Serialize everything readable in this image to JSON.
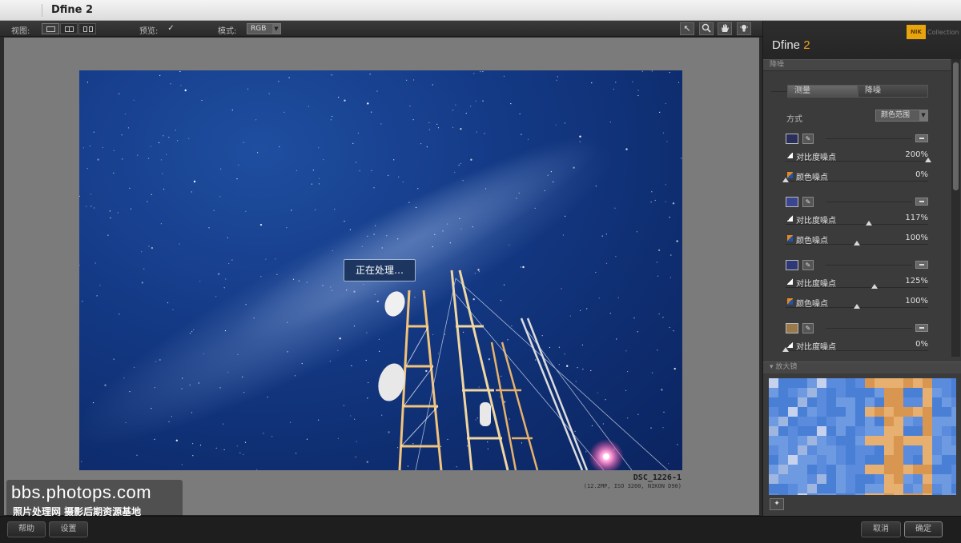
{
  "window": {
    "title": "Dfine 2"
  },
  "toolbar": {
    "view_label": "视图:",
    "preview_label": "预览:",
    "preview_checked": "✓",
    "mode_label": "模式:",
    "mode_value": "RGB"
  },
  "image": {
    "filename": "DSC_1226-1",
    "meta": "(12.2MP, ISO 3200, NIKON D90)",
    "processing_text": "正在处理…"
  },
  "watermark": {
    "url": "bbs.photops.com",
    "subtitle": "照片处理网 摄影后期资源基地"
  },
  "bottom": {
    "help": "帮助",
    "settings": "设置",
    "cancel": "取消",
    "ok": "确定"
  },
  "panel": {
    "brand_name": "Dfine",
    "brand_version": "2",
    "nik_badge": "NIK",
    "nik_collection": "Collection",
    "section_noise_reduction": "降噪",
    "tab_measure": "测量",
    "tab_reduce": "降噪",
    "method_label": "方式",
    "method_value": "颜色范围",
    "color_points": [
      {
        "swatch": "#2a2e5a",
        "contrast_label": "对比度噪点",
        "contrast_value": "200%",
        "contrast_level": 1.0,
        "color_label": "颜色噪点",
        "color_value": "0%",
        "color_level": 0.0
      },
      {
        "swatch": "#3a4690",
        "contrast_label": "对比度噪点",
        "contrast_value": "117%",
        "contrast_level": 0.585,
        "color_label": "颜色噪点",
        "color_value": "100%",
        "color_level": 0.5
      },
      {
        "swatch": "#2e3878",
        "contrast_label": "对比度噪点",
        "contrast_value": "125%",
        "contrast_level": 0.625,
        "color_label": "颜色噪点",
        "color_value": "100%",
        "color_level": 0.5
      },
      {
        "swatch": "#9a7a4a",
        "contrast_label": "对比度噪点",
        "contrast_value": "0%",
        "contrast_level": 0.0
      }
    ],
    "section_loupe": "▾ 放大镜"
  },
  "icons": {
    "arrow_tool": "↖",
    "zoom_tool": "🔍",
    "hand_tool": "✋",
    "bulb_tool": "💡",
    "picker": "✎",
    "pin": "✦"
  }
}
